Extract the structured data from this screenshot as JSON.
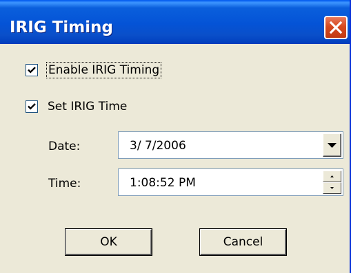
{
  "window": {
    "title": "IRIG Timing"
  },
  "options": {
    "enable_irig_label": "Enable IRIG Timing",
    "enable_irig_checked": true,
    "set_irig_time_label": "Set IRIG Time",
    "set_irig_time_checked": true
  },
  "date": {
    "label": "Date:",
    "value": "3/ 7/2006"
  },
  "time": {
    "label": "Time:",
    "value": "1:08:52 PM"
  },
  "buttons": {
    "ok": "OK",
    "cancel": "Cancel"
  },
  "icons": {
    "close": "close-icon",
    "check": "checkmark-icon",
    "dropdown": "chevron-down-icon",
    "spin_up": "arrow-up-icon",
    "spin_down": "arrow-down-icon"
  },
  "colors": {
    "titlebar": "#0453d6",
    "close_button": "#d6491f",
    "dialog_face": "#ece9d8"
  }
}
